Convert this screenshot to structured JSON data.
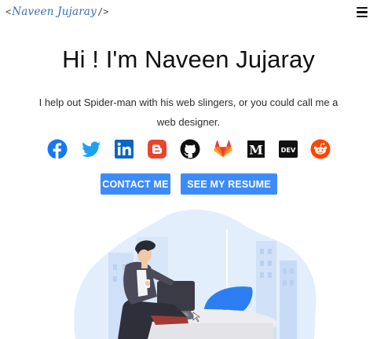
{
  "nav": {
    "logo_open": "<",
    "logo_name": "Naveen Jujaray",
    "logo_close": "/>",
    "menu_icon": "hamburger-menu-icon"
  },
  "hero": {
    "title": "Hi ! I'm Naveen Jujaray",
    "subtitle": "I help out Spider-man with his web slingers, or you could call me a web designer."
  },
  "socials": [
    {
      "icon": "facebook-icon",
      "color": "#1877f2"
    },
    {
      "icon": "twitter-icon",
      "color": "#1da1f2"
    },
    {
      "icon": "linkedin-icon",
      "color": "#0a66c2"
    },
    {
      "icon": "blogger-icon",
      "color": "#e8452c"
    },
    {
      "icon": "github-icon",
      "color": "#111111"
    },
    {
      "icon": "gitlab-icon",
      "color": "#fc6d26"
    },
    {
      "icon": "medium-icon",
      "color": "#111111",
      "text": "M"
    },
    {
      "icon": "dev-to-icon",
      "color": "#111111",
      "text": "DEV"
    },
    {
      "icon": "reddit-icon",
      "color": "#ff4500"
    }
  ],
  "buttons": {
    "contact": "CONTACT ME",
    "resume": "SEE MY RESUME"
  },
  "colors": {
    "accent": "#3d8bf8",
    "blob": "#e3eefc",
    "chair": "#2c7df2"
  },
  "illustration": {
    "icon": "person-working-at-desk-illustration"
  }
}
